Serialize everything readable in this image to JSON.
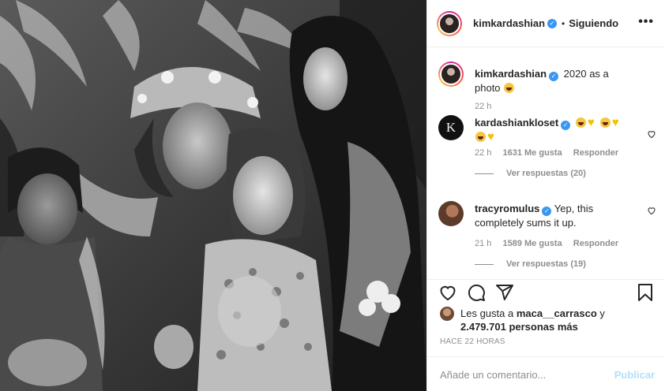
{
  "post": {
    "photo_alt": "2020 as a photo"
  },
  "header": {
    "username": "kimkardashian",
    "separator": "•",
    "follow_state": "Siguiendo",
    "more": "•••"
  },
  "caption": {
    "username": "kimkardashian",
    "text": "2020 as a photo",
    "time": "22 h"
  },
  "comments": [
    {
      "username": "kardashiankloset",
      "avatar_letter": "K",
      "text_emojis": [
        "laugh",
        "heart",
        "laugh",
        "heart",
        "laugh",
        "heart"
      ],
      "time": "22 h",
      "likes": "1631 Me gusta",
      "reply": "Responder",
      "view_replies": "Ver respuestas (20)"
    },
    {
      "username": "tracyromulus",
      "text": "Yep, this completely sums it up.",
      "time": "21 h",
      "likes": "1589 Me gusta",
      "reply": "Responder",
      "view_replies": "Ver respuestas (19)"
    }
  ],
  "actions": {
    "icons": [
      "heart-icon",
      "comment-icon",
      "share-icon",
      "bookmark-icon"
    ]
  },
  "likes_summary": {
    "prefix": "Les gusta a",
    "user": "maca__carrasco",
    "conjunction": "y",
    "count": "2.479.701 personas más"
  },
  "timestamp": "HACE 22 HORAS",
  "comment_box": {
    "placeholder": "Añade un comentario...",
    "publish_label": "Publicar"
  },
  "colors": {
    "verified": "#3897f0",
    "publish_disabled": "#b2dffc",
    "secondary_text": "#8e8e8e"
  }
}
